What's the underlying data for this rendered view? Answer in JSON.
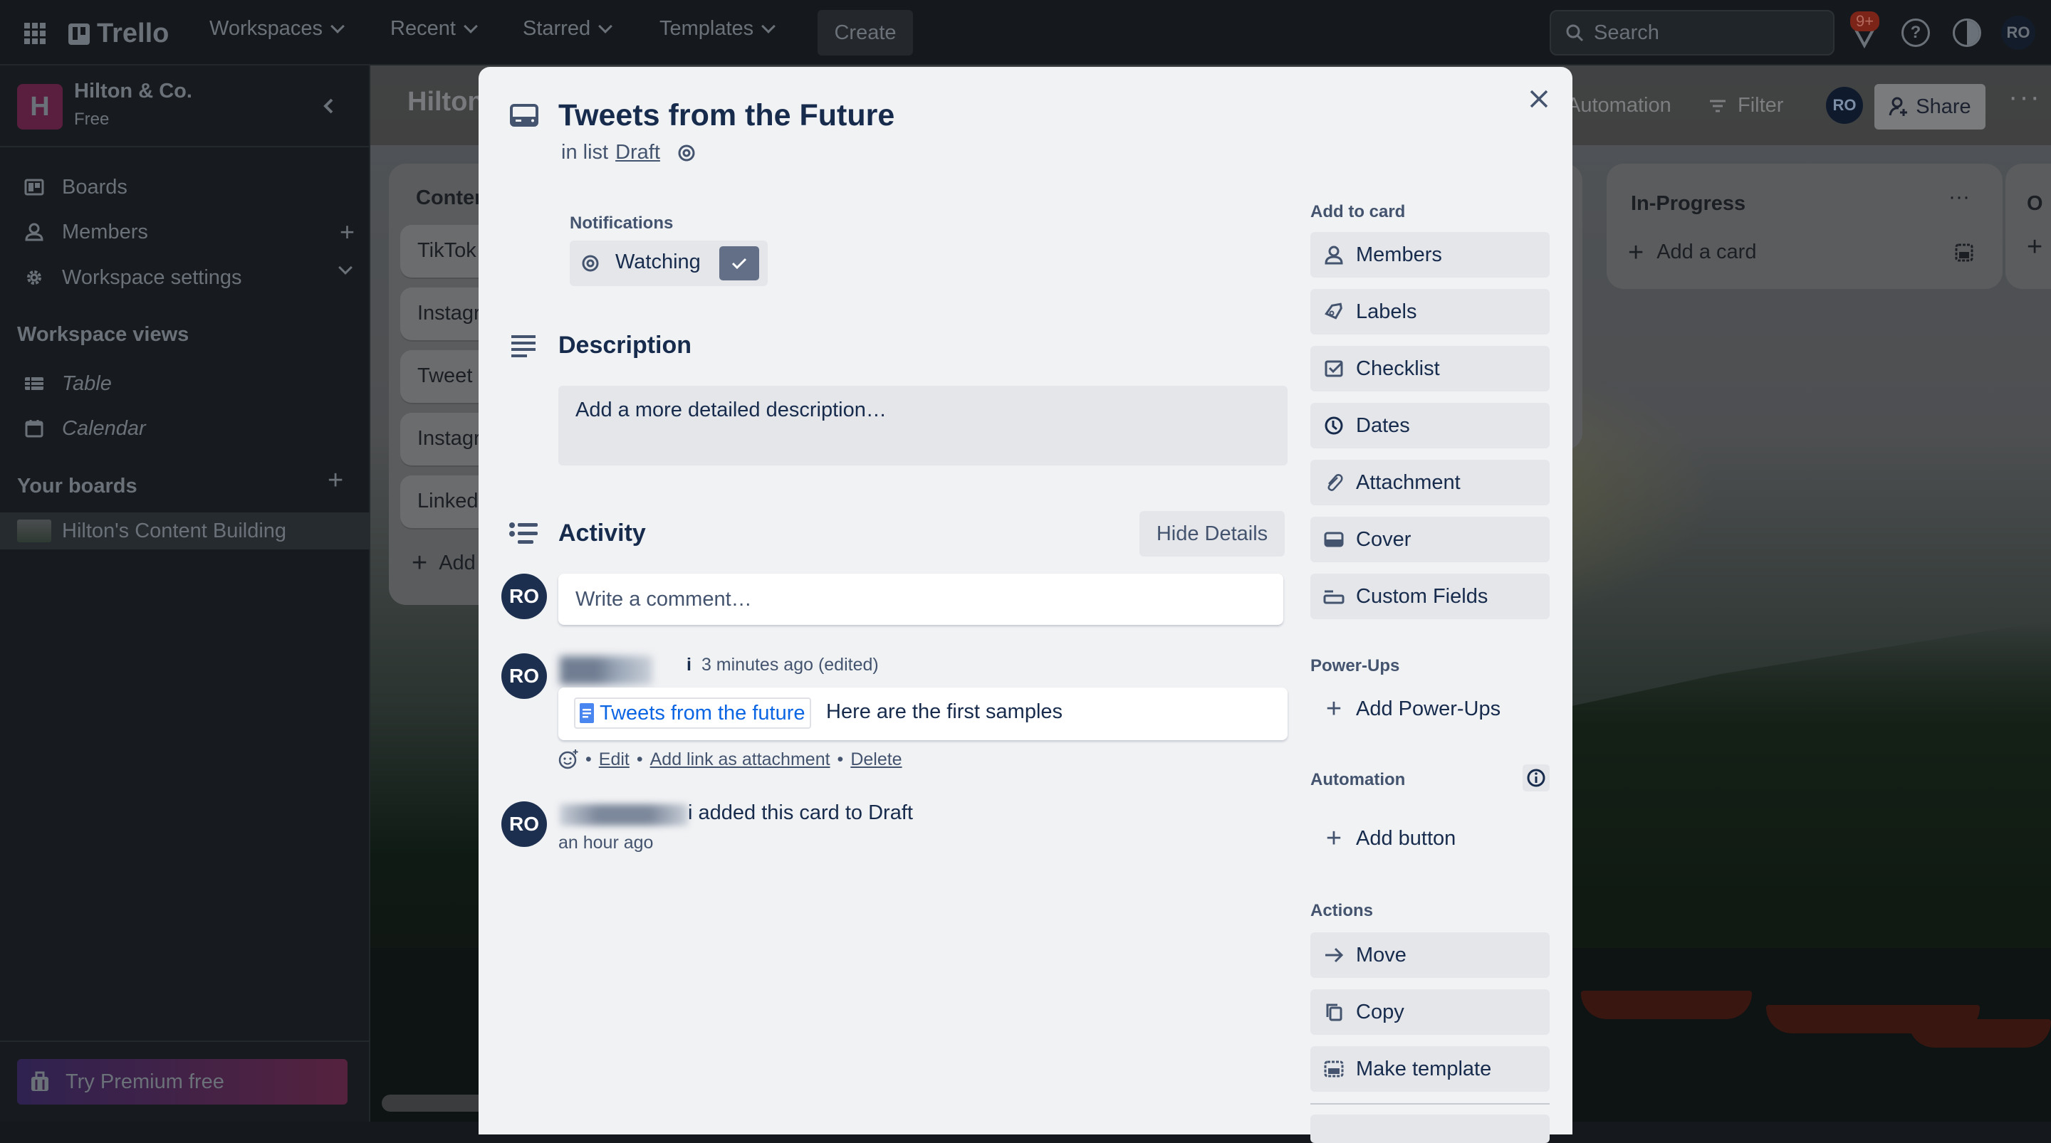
{
  "topnav": {
    "app_name": "Trello",
    "menus": [
      "Workspaces",
      "Recent",
      "Starred",
      "Templates"
    ],
    "create_label": "Create",
    "search_placeholder": "Search",
    "notifications_badge": "9+",
    "avatar_initials": "RO"
  },
  "sidebar": {
    "workspace_initial": "H",
    "workspace_name": "Hilton & Co.",
    "workspace_plan": "Free",
    "items": [
      {
        "label": "Boards"
      },
      {
        "label": "Members"
      },
      {
        "label": "Workspace settings"
      }
    ],
    "views_heading": "Workspace views",
    "views": [
      {
        "label": "Table"
      },
      {
        "label": "Calendar"
      }
    ],
    "boards_heading": "Your boards",
    "boards": [
      {
        "label": "Hilton's Content Building"
      }
    ],
    "premium_label": "Try Premium free"
  },
  "board": {
    "title_partial": "Hilton",
    "automation_label": "Automation",
    "filter_label": "Filter",
    "share_label": "Share",
    "member_initials": "RO",
    "lists": [
      {
        "title": "Conter",
        "cards": [
          "TikTok",
          "Instagr",
          "Tweet",
          "Instagr",
          "LinkedI"
        ],
        "add_label": "Add"
      },
      {
        "title": "In-Progress",
        "cards": [],
        "add_label": "Add a card"
      },
      {
        "title": "O",
        "cards": [],
        "add_label": ""
      }
    ]
  },
  "card_modal": {
    "title": "Tweets from the Future",
    "in_list_prefix": "in list",
    "list_name": "Draft",
    "notifications_heading": "Notifications",
    "watching_label": "Watching",
    "description_heading": "Description",
    "description_placeholder": "Add a more detailed description…",
    "activity_heading": "Activity",
    "hide_details_label": "Hide Details",
    "comment_placeholder": "Write a comment…",
    "activity": [
      {
        "avatar": "RO",
        "meta": "3 minutes ago (edited)",
        "link_text": "Tweets from the future",
        "comment_text": "Here are the first samples",
        "actions": [
          "Edit",
          "Add link as attachment",
          "Delete"
        ]
      },
      {
        "avatar": "RO",
        "text": "i added this card to Draft",
        "time": "an hour ago"
      }
    ],
    "add_to_card_heading": "Add to card",
    "add_to_card": [
      {
        "label": "Members",
        "icon": "person-icon"
      },
      {
        "label": "Labels",
        "icon": "tag-icon"
      },
      {
        "label": "Checklist",
        "icon": "checklist-icon"
      },
      {
        "label": "Dates",
        "icon": "clock-icon"
      },
      {
        "label": "Attachment",
        "icon": "paperclip-icon"
      },
      {
        "label": "Cover",
        "icon": "cover-icon"
      },
      {
        "label": "Custom Fields",
        "icon": "custom-fields-icon"
      }
    ],
    "powerups_heading": "Power-Ups",
    "add_powerups_label": "Add Power-Ups",
    "automation_heading": "Automation",
    "add_button_label": "Add button",
    "actions_heading": "Actions",
    "actions": [
      {
        "label": "Move",
        "icon": "arrow-right-icon"
      },
      {
        "label": "Copy",
        "icon": "copy-icon"
      },
      {
        "label": "Make template",
        "icon": "template-icon"
      }
    ]
  }
}
